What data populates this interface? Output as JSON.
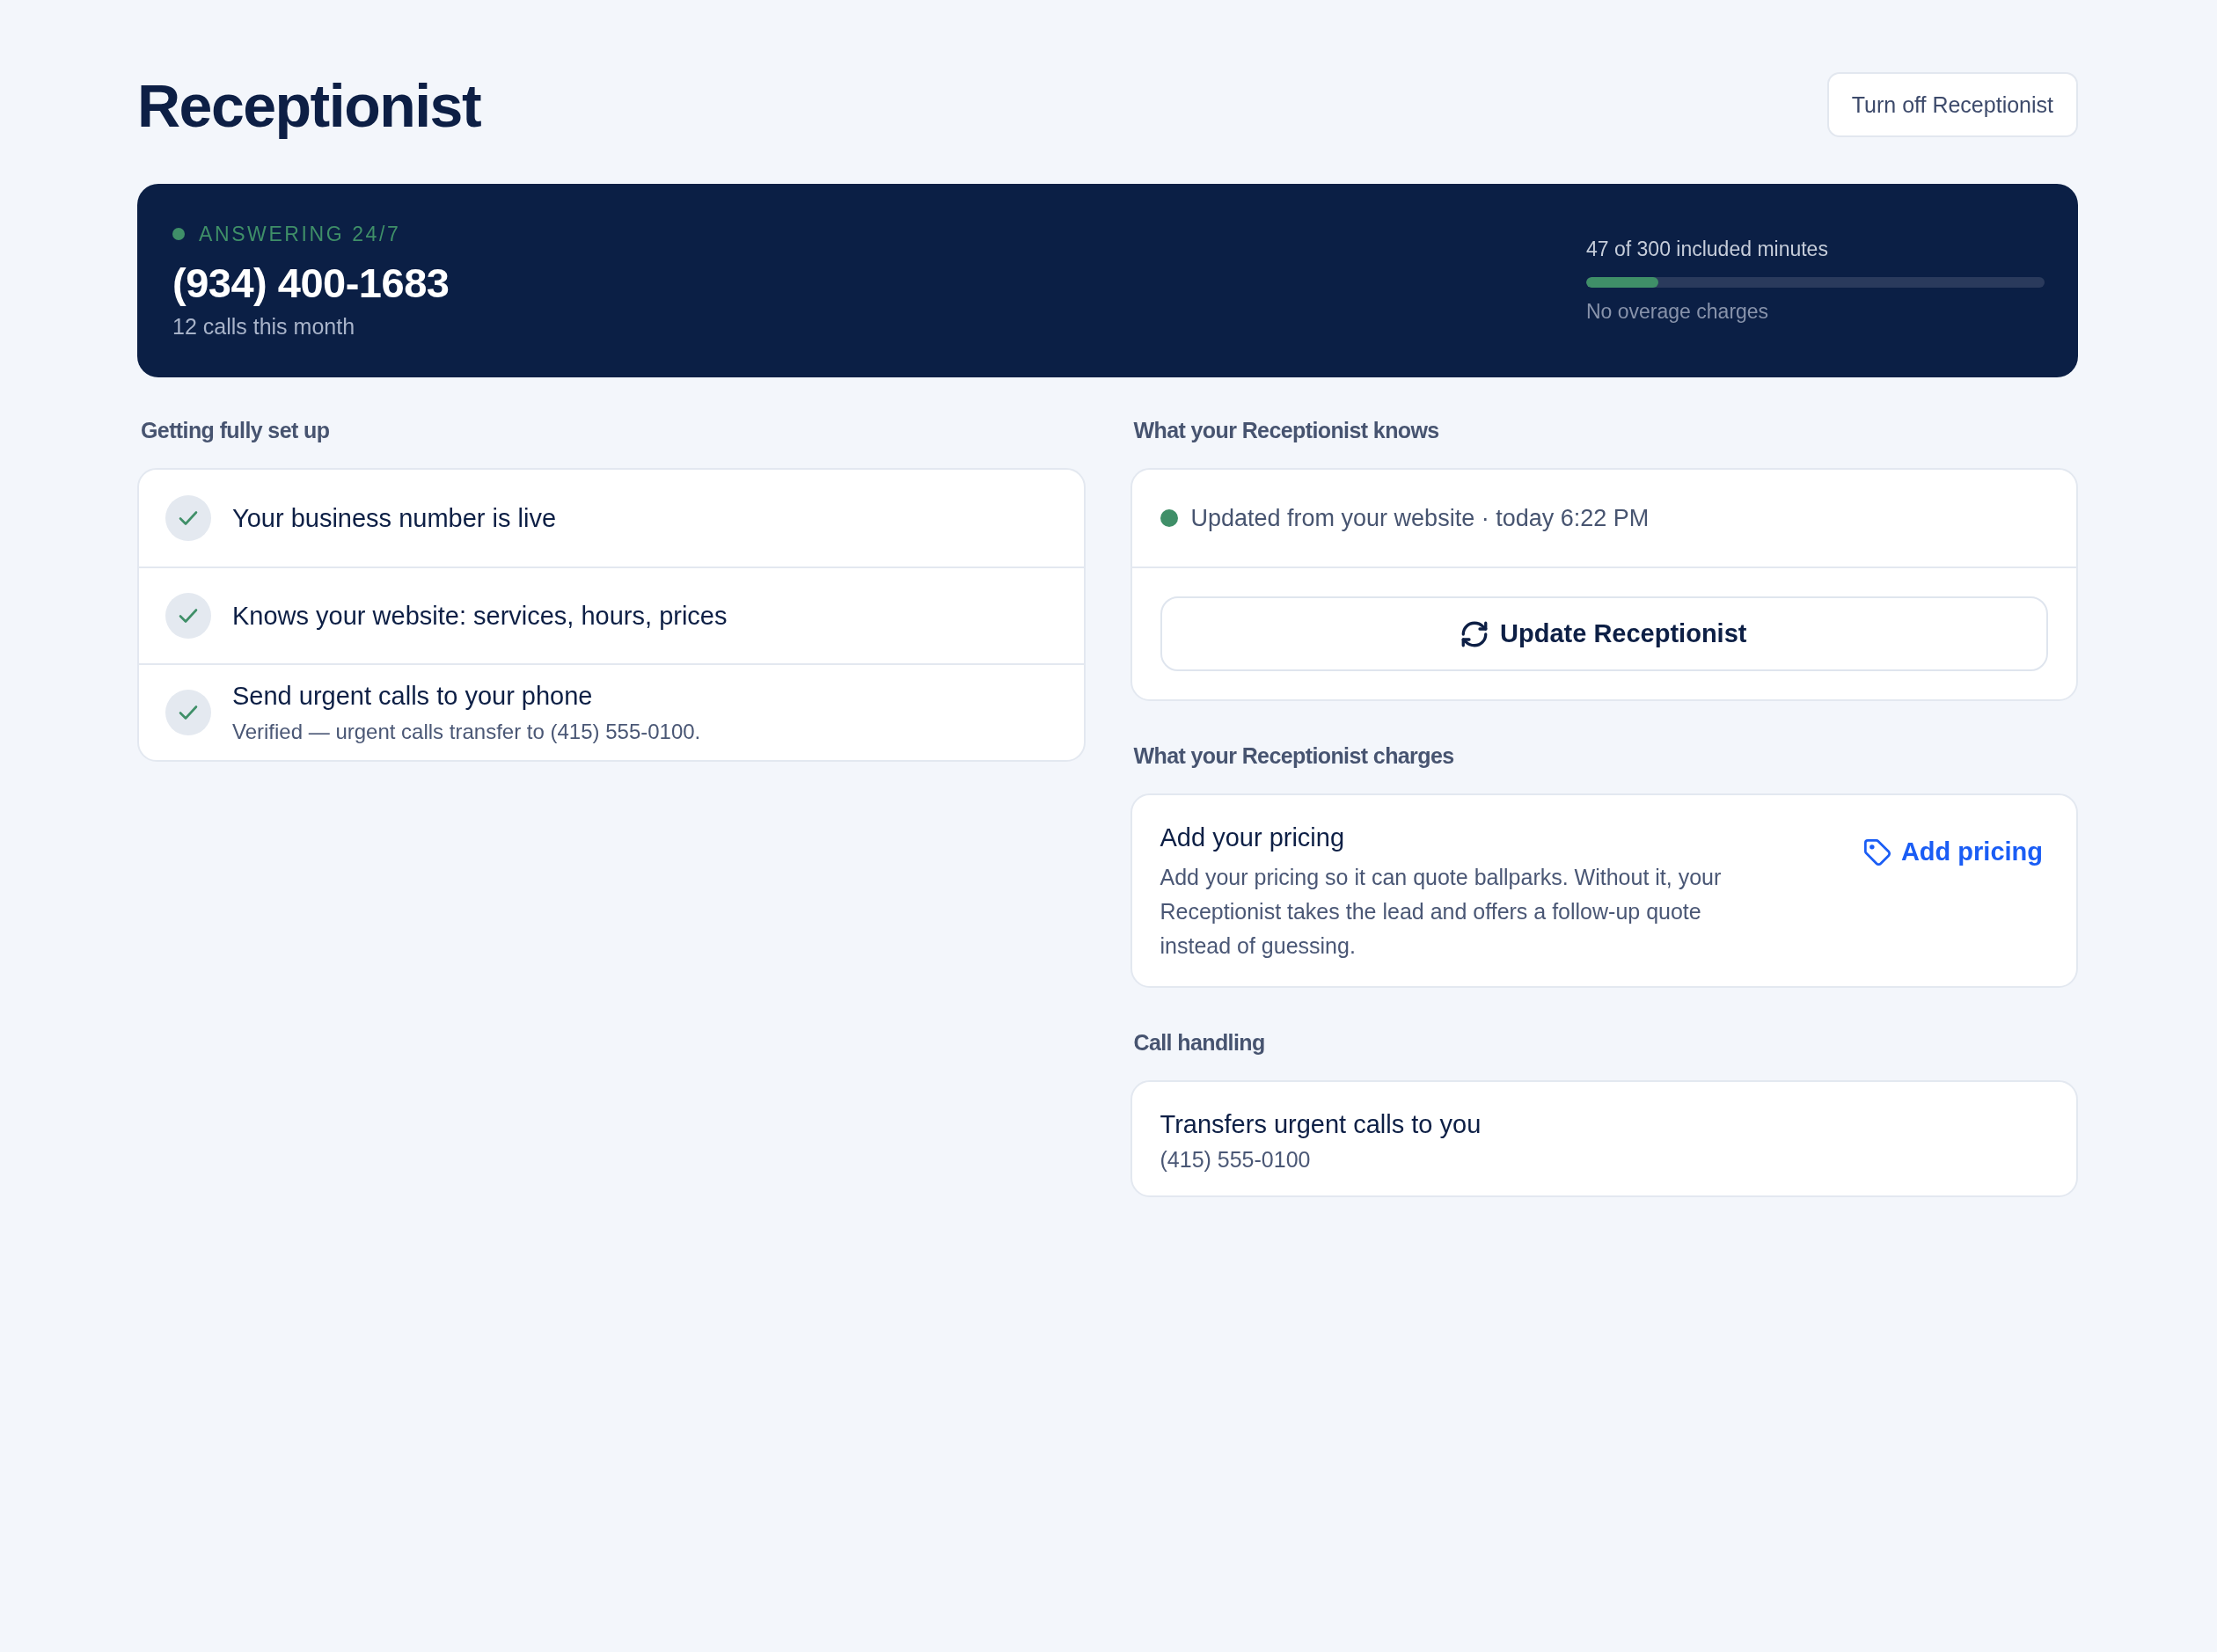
{
  "page": {
    "title": "Receptionist",
    "action_button": "Turn off Receptionist"
  },
  "status_banner": {
    "status": "ANSWERING 24/7",
    "phone_number": "(934) 400-1683",
    "calls_summary": "12 calls this month",
    "usage": {
      "label": "47 of 300 included minutes",
      "level": 0.157,
      "note": "No overage charges"
    }
  },
  "setup": {
    "heading": "Getting fully set up",
    "steps": [
      {
        "title": "Your business number is live",
        "checked": true
      },
      {
        "title": "Knows your website: services, hours, prices",
        "checked": true
      },
      {
        "title": "Send urgent calls to your phone",
        "detail": "Verified — urgent calls transfer to (415) 555-0100.",
        "checked": true
      }
    ]
  },
  "knowledge": {
    "heading": "What your Receptionist knows",
    "status": "Updated from your website · today 6:22 PM",
    "button": "Update Receptionist"
  },
  "charges": {
    "heading": "What your Receptionist charges",
    "title": "Add your pricing",
    "description": "Add your pricing so it can quote ballparks. Without it, your Receptionist takes the lead and offers a follow-up quote instead of guessing.",
    "link": "Add pricing"
  },
  "call_handling": {
    "heading": "Call handling",
    "title": "Transfers urgent calls to you",
    "detail": "(415) 555-0100"
  }
}
